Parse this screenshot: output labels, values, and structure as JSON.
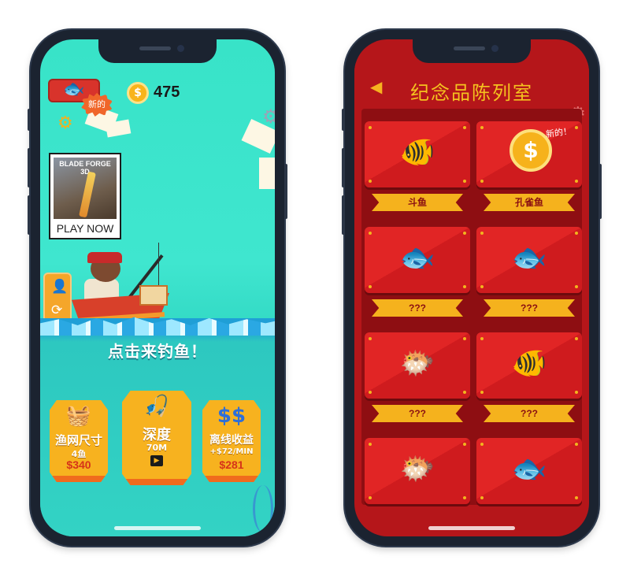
{
  "left_phone": {
    "fish_badge_icon": "fish-icon",
    "new_badge": "新的",
    "coins": "475",
    "ad": {
      "title": "BLADE FORGE 3D",
      "cta": "PLAY NOW"
    },
    "tap_prompt": "点击来钓鱼！",
    "upgrades": [
      {
        "title": "渔网尺寸",
        "value": "4鱼",
        "price": "$340",
        "icon": "net-icon"
      },
      {
        "title": "深度",
        "value": "70M",
        "icon": "fishing-rod-icon",
        "extra_icon": "video-icon"
      },
      {
        "title": "离线收益",
        "value": "+$72/MIN",
        "price": "$281",
        "icon": "dollar-icon"
      }
    ]
  },
  "right_phone": {
    "title": "纪念品陈列室",
    "collection": [
      {
        "label": "斗鱼",
        "icon": "fish-icon",
        "known": true
      },
      {
        "label": "孔雀鱼",
        "icon": "coin-icon",
        "known": true,
        "badge": "新的！"
      },
      {
        "label": "???",
        "icon": "fish-silhouette-icon",
        "known": false
      },
      {
        "label": "???",
        "icon": "flying-fish-silhouette-icon",
        "known": false
      },
      {
        "label": "???",
        "icon": "lionfish-silhouette-icon",
        "known": false
      },
      {
        "label": "???",
        "icon": "angelfish-silhouette-icon",
        "known": false
      },
      {
        "icon": "pufferfish-silhouette-icon",
        "known": false
      },
      {
        "icon": "clownfish-silhouette-icon",
        "known": false
      }
    ]
  },
  "colors": {
    "sea_top": "#38e3c8",
    "upgrade_gold": "#f7b21f",
    "trophy_red": "#b5161a",
    "ribbon_gold": "#f5b21d"
  }
}
